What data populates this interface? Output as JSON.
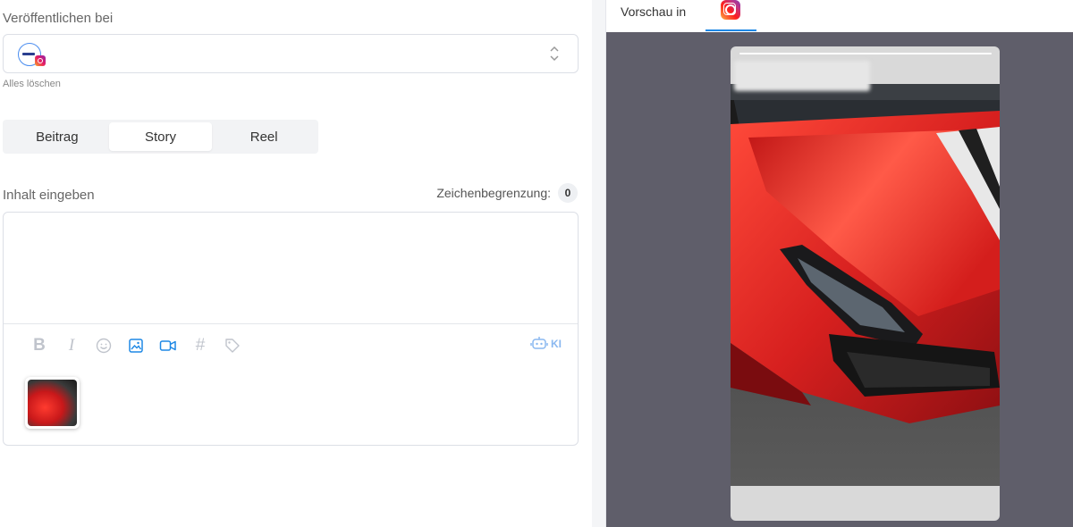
{
  "publish": {
    "label": "Veröffentlichen bei",
    "clear_all": "Alles löschen"
  },
  "post_types": [
    {
      "label": "Beitrag",
      "active": false
    },
    {
      "label": "Story",
      "active": true
    },
    {
      "label": "Reel",
      "active": false
    }
  ],
  "content": {
    "label": "Inhalt eingeben",
    "char_limit_label": "Zeichenbegrenzung:",
    "char_count": "0",
    "text_value": ""
  },
  "toolbar": {
    "bold": "B",
    "italic": "I",
    "hashtag": "#",
    "ai_label": "KI"
  },
  "preview": {
    "label": "Vorschau in",
    "platform_icon": "instagram-icon"
  },
  "colors": {
    "accent": "#1e88e5",
    "preview_bg": "#5f5e6a",
    "car_red": "#d7201f"
  }
}
